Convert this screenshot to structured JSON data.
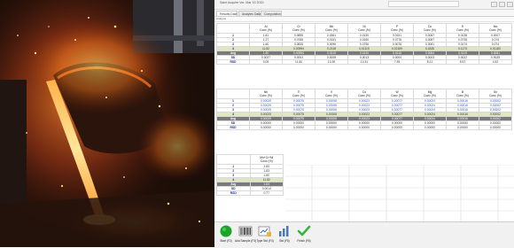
{
  "window": {
    "title": "Saint Acquire Ver. Mar 15 2015",
    "toolbox_text": "",
    "tabs": [
      "Results Data",
      "Analytes Data",
      "Composition"
    ],
    "subbar_text": "Analysis"
  },
  "table1": {
    "headers": [
      [
        "Al",
        "Conc (%)"
      ],
      [
        "Cr",
        "Conc (%)"
      ],
      [
        "Mn",
        "Conc (%)"
      ],
      [
        "Ni",
        "Conc (%)"
      ],
      [
        "P",
        "Conc (%)"
      ],
      [
        "Cu",
        "Conc (%)"
      ],
      [
        "S",
        "Conc (%)"
      ],
      [
        "Mo",
        "Conc (%)"
      ]
    ],
    "rows": [
      {
        "label": "1",
        "cells": [
          "1.81",
          "0.0855",
          "0.0361",
          "0.0130",
          "0.0151",
          "0.0087",
          "0.0138",
          "0.0007"
        ],
        "style": ""
      },
      {
        "label": "2",
        "cells": [
          "1.27",
          "0.0786",
          "0.0151",
          "0.0160",
          "0.0776",
          "0.0087",
          "0.0735",
          "0.074"
        ],
        "style": ""
      },
      {
        "label": "3",
        "cells": [
          "1.60",
          "0.0825",
          "0.0096",
          "0.0796",
          "0.0078",
          "0.0081",
          "0.0174",
          "0.074"
        ],
        "style": ""
      },
      {
        "label": "4",
        "cells": [
          "11.82",
          "0.00954",
          "0.2118",
          "0.01119",
          "0.02189",
          "0.4335",
          "0.1173",
          "0.01180"
        ],
        "style": "hl"
      },
      {
        "label": "Avg",
        "cells": [
          "1.80",
          "0.00954",
          "0.0115",
          "0.0130",
          "0.0116",
          "0.0084",
          "0.0119",
          "0.0081"
        ],
        "style": "dark"
      },
      {
        "label": "SD",
        "cells": [
          "0.0027",
          "0.0004",
          "0.0008",
          "0.0013",
          "0.0004",
          "0.0003",
          "0.0022",
          "0.0025"
        ],
        "style": ""
      },
      {
        "label": "RSD",
        "cells": [
          "0.05",
          "11.60",
          "10.39",
          "10.31",
          "7.39",
          "8.21",
          "8.57",
          "4.52"
        ],
        "style": ""
      }
    ]
  },
  "table2": {
    "headers": [
      [
        "Nb",
        "Conc (%)"
      ],
      [
        "Ti",
        "Conc (%)"
      ],
      [
        "V",
        "Conc (%)"
      ],
      [
        "Co",
        "Conc (%)"
      ],
      [
        "W",
        "Conc (%)"
      ],
      [
        "Mg",
        "Conc (%)"
      ],
      [
        "B",
        "Conc (%)"
      ],
      [
        "Sn",
        "Conc (%)"
      ]
    ],
    "rows": [
      {
        "label": "1",
        "cells": [
          "0.00025",
          "0.00075",
          "0.00008",
          "0.00023",
          "0.00077",
          "0.00024",
          "0.00016",
          "0.00002"
        ],
        "style": "blue"
      },
      {
        "label": "2",
        "cells": [
          "0.00025",
          "0.00075",
          "0.00008",
          "0.00023",
          "0.00077",
          "0.00024",
          "0.00016",
          "0.00002"
        ],
        "style": "blue"
      },
      {
        "label": "3",
        "cells": [
          "0.00025",
          "0.00075",
          "0.00008",
          "0.00023",
          "0.00077",
          "0.00024",
          "0.00016",
          "0.00002"
        ],
        "style": "blue"
      },
      {
        "label": "4",
        "cells": [
          "0.00025",
          "0.00075",
          "0.00008",
          "0.00023",
          "0.00077",
          "0.00024",
          "0.00016",
          "0.00002"
        ],
        "style": "hl"
      },
      {
        "label": "Avg",
        "cells": [
          "0.00025",
          "0.00075",
          "0.00008",
          "0.00023",
          "0.00077",
          "0.00024",
          "0.00016",
          "0.00002"
        ],
        "style": "dark"
      },
      {
        "label": "SD",
        "cells": [
          "0.00000",
          "0.00000",
          "0.00000",
          "0.00000",
          "0.00000",
          "0.00000",
          "0.00000",
          "0.00000"
        ],
        "style": ""
      },
      {
        "label": "RSD",
        "cells": [
          "0.00000",
          "0.00000",
          "0.00000",
          "0.00000",
          "0.00000",
          "0.00000",
          "0.00000",
          "0.00000"
        ],
        "style": ""
      }
    ]
  },
  "table3": {
    "header": [
      "Mn+Cr+Ni",
      "Conc (%)"
    ],
    "rows": [
      {
        "label": "1",
        "value": "1.83",
        "style": ""
      },
      {
        "label": "2",
        "value": "1.83",
        "style": ""
      },
      {
        "label": "3",
        "value": "1.80",
        "style": ""
      },
      {
        "label": "4",
        "value": "11.82",
        "style": "hl"
      },
      {
        "label": "Avg",
        "value": "1.83",
        "style": "dark"
      },
      {
        "label": "SD",
        "value": "0.0014",
        "style": ""
      },
      {
        "label": "RSD",
        "value": "0.77",
        "style": ""
      }
    ]
  },
  "toolbar": [
    {
      "label": "Start (F2)",
      "icon": "start-icon"
    },
    {
      "label": "Add Sample (F3)",
      "icon": "barcode-icon"
    },
    {
      "label": "Type Std (F4)",
      "icon": "type-standard-icon"
    },
    {
      "label": "Std (F5)",
      "icon": "standard-chart-icon"
    },
    {
      "label": "Finish (F6)",
      "icon": "finish-check-icon"
    }
  ],
  "colors": {
    "start": "#18a52a",
    "finish": "#3db33c",
    "highlight_row": "#dfe7c2",
    "summary_row": "#7a7a7a",
    "blue_text": "#2f57c9",
    "label_text": "#1b2a8a"
  }
}
